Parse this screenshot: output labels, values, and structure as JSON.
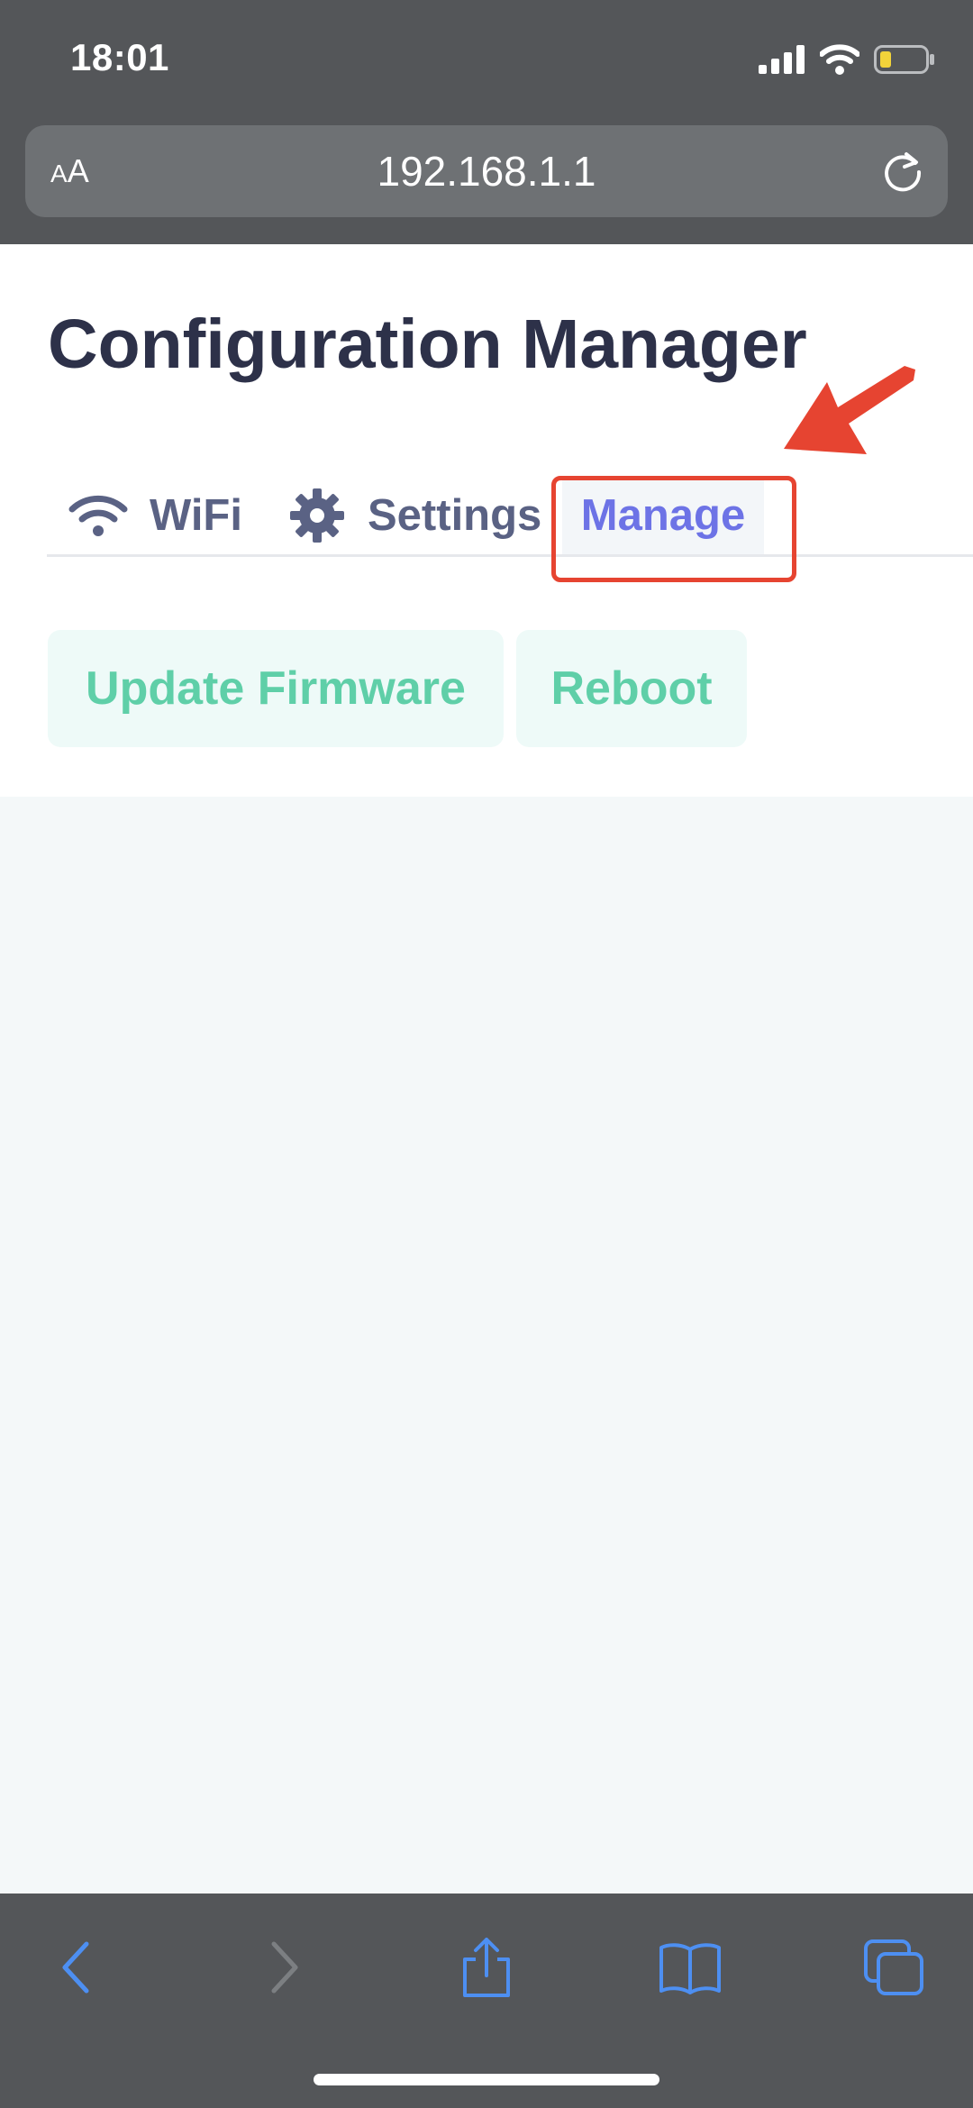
{
  "status_bar": {
    "time": "18:01"
  },
  "browser": {
    "text_size_label_small": "A",
    "text_size_label_large": "A",
    "url": "192.168.1.1"
  },
  "page": {
    "title": "Configuration Manager",
    "tabs": [
      {
        "label": "WiFi",
        "icon": "wifi-icon"
      },
      {
        "label": "Settings",
        "icon": "gear-icon"
      },
      {
        "label": "Manage",
        "active": true
      }
    ],
    "buttons": {
      "update_firmware": "Update Firmware",
      "reboot": "Reboot"
    }
  },
  "toolbar": {
    "icons": [
      "back-icon",
      "forward-icon",
      "share-icon",
      "bookmarks-icon",
      "tabs-icon"
    ]
  },
  "colors": {
    "accent": "#6d73e6",
    "button_text": "#5fcfa8",
    "annotation": "#e64431",
    "title": "#2d3149"
  }
}
